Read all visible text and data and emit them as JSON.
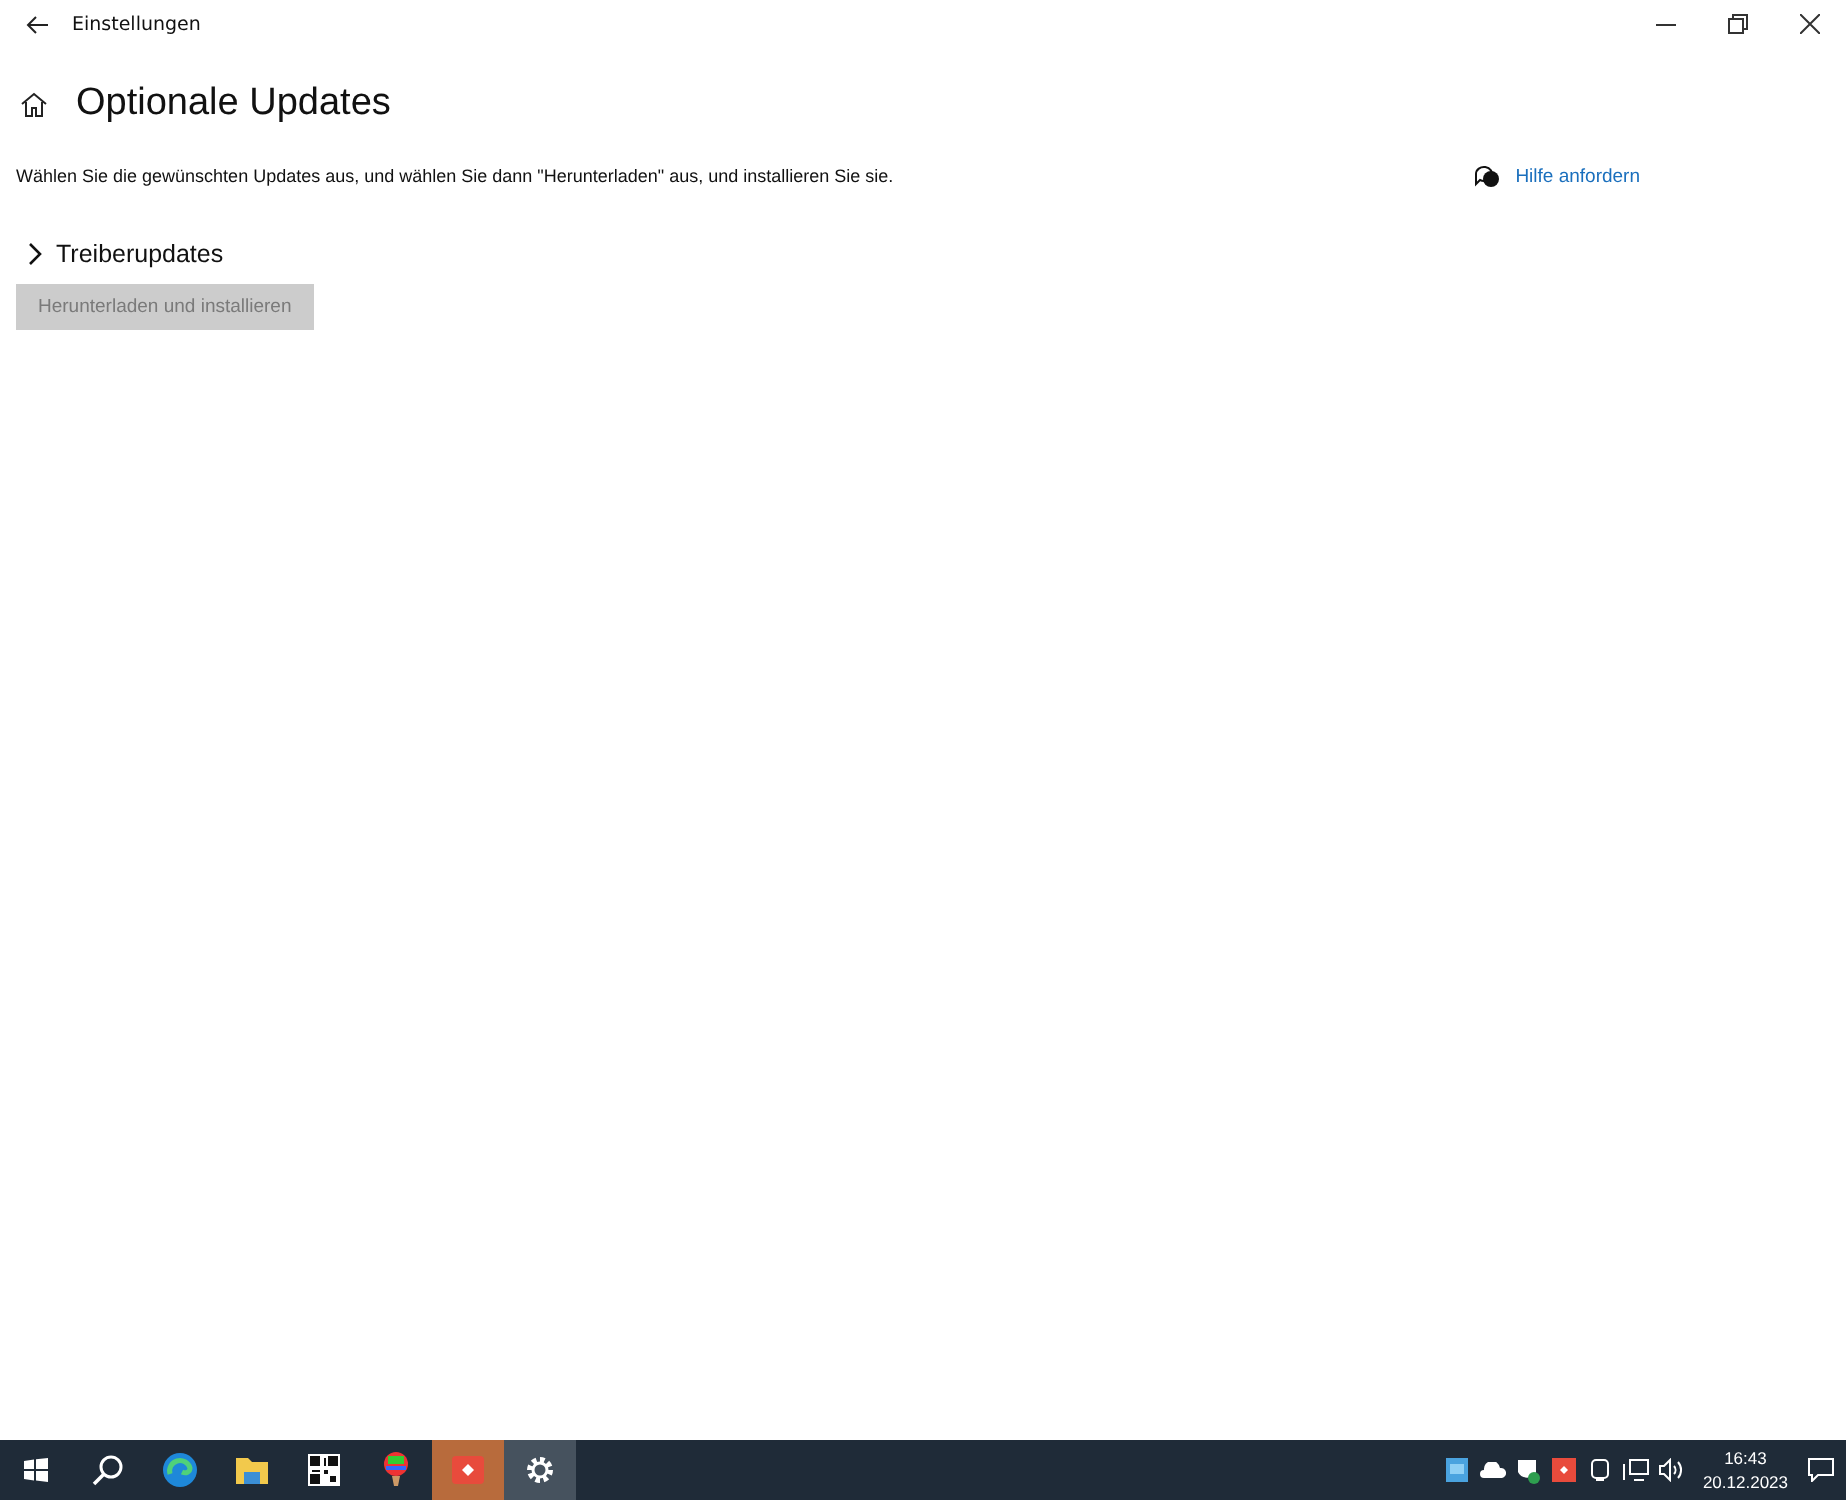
{
  "window": {
    "title": "Einstellungen"
  },
  "page": {
    "title": "Optionale Updates",
    "description": "Wählen Sie die gewünschten Updates aus, und wählen Sie dann \"Herunterladen\" aus, und installieren Sie sie.",
    "help_link": "Hilfe anfordern"
  },
  "sections": [
    {
      "label": "Treiberupdates",
      "expanded": false
    }
  ],
  "download_button": {
    "label": "Herunterladen und installieren",
    "disabled": true
  },
  "taskbar": {
    "apps": [
      {
        "kind": "start"
      },
      {
        "kind": "search"
      },
      {
        "kind": "browser"
      },
      {
        "kind": "folder"
      },
      {
        "kind": "qr"
      },
      {
        "kind": "balloon"
      },
      {
        "kind": "remote",
        "selected": false
      },
      {
        "kind": "settings",
        "selected": true
      }
    ],
    "tray": [
      {
        "kind": "app"
      },
      {
        "kind": "cloud"
      },
      {
        "kind": "shield"
      },
      {
        "kind": "remote"
      },
      {
        "kind": "camera"
      },
      {
        "kind": "network"
      },
      {
        "kind": "volume"
      }
    ],
    "time": "16:43",
    "date": "20.12.2023"
  }
}
